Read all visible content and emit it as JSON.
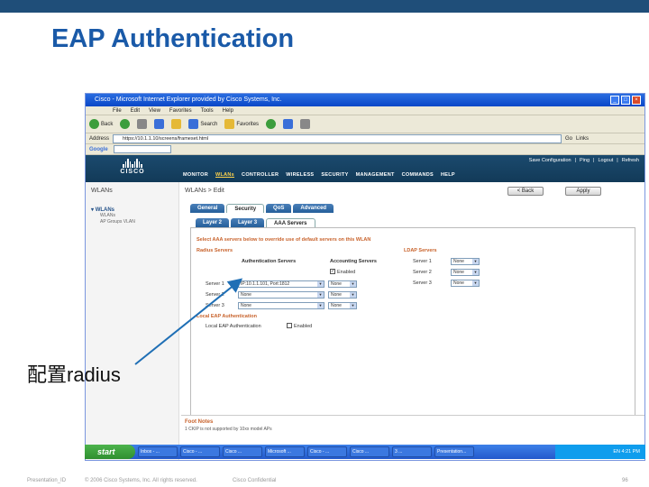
{
  "slide": {
    "title": "EAP Authentication",
    "annotation": "配置radius",
    "footer": {
      "presentation": "Presentation_ID",
      "copyright": "© 2006 Cisco Systems, Inc. All rights reserved.",
      "confidential": "Cisco Confidential",
      "page": "96"
    }
  },
  "browser": {
    "title": "Cisco - Microsoft Internet Explorer provided by Cisco Systems, Inc.",
    "menu": [
      "File",
      "Edit",
      "View",
      "Favorites",
      "Tools",
      "Help"
    ],
    "toolbar": {
      "back": "Back",
      "search": "Search",
      "favorites": "Favorites"
    },
    "address_label": "Address",
    "address": "https://10.1.1.10/screens/frameset.html",
    "go": "Go",
    "links": "Links",
    "google_label": "Google"
  },
  "wlc": {
    "logo": "CISCO",
    "top_links": [
      "Save Configuration",
      "Ping",
      "Logout",
      "Refresh"
    ],
    "nav": [
      "MONITOR",
      "WLANs",
      "CONTROLLER",
      "WIRELESS",
      "SECURITY",
      "MANAGEMENT",
      "COMMANDS",
      "HELP"
    ],
    "left_title": "WLANs",
    "left_tree": "WLANs",
    "left_sub": [
      "WLANs",
      "AP Groups VLAN"
    ],
    "breadcrumb": "WLANs > Edit",
    "back": "< Back",
    "apply": "Apply",
    "tabs": [
      "General",
      "Security",
      "QoS",
      "Advanced"
    ],
    "subtabs": [
      "Layer 2",
      "Layer 3",
      "AAA Servers"
    ],
    "instruction": "Select AAA servers below to override use of default servers on this WLAN",
    "radius_section": "Radius Servers",
    "ldap_section": "LDAP Servers",
    "auth_col": "Authentication Servers",
    "acct_col": "Accounting Servers",
    "enabled_label": "Enabled",
    "radius_rows": [
      {
        "label": "Server 1",
        "auth": "IP:10.1.1.101, Port:1812",
        "acct": "None"
      },
      {
        "label": "Server 2",
        "auth": "None",
        "acct": "None"
      },
      {
        "label": "Server 3",
        "auth": "None",
        "acct": "None"
      }
    ],
    "ldap_rows": [
      {
        "label": "Server 1",
        "value": "None"
      },
      {
        "label": "Server 2",
        "value": "None"
      },
      {
        "label": "Server 3",
        "value": "None"
      }
    ],
    "local_eap_section": "Local EAP Authentication",
    "local_eap_label": "Local EAP Authentication",
    "local_eap_enabled": "Enabled",
    "foot_title": "Foot Notes",
    "foot_note": "1 CKIP is not supported by 10xx model APs"
  },
  "taskbar": {
    "start": "start",
    "tasks": [
      "Inbox - ...",
      "Cisco - ...",
      "Cisco ...",
      "Microsoft ...",
      "Cisco - ...",
      "Cisco ...",
      "3 ...",
      "Presentation..."
    ],
    "clock": "EN 4:21 PM"
  },
  "colors": {
    "title": "#1a5aa8",
    "topbar": "#1f4e79",
    "wlc_header": "#1b4a6e",
    "section": "#c8622b",
    "arrow": "#1f6fb5"
  }
}
